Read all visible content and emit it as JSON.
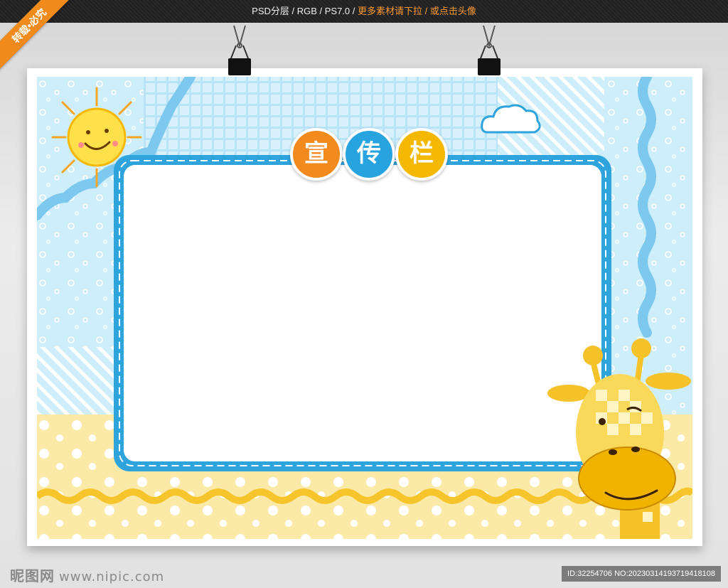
{
  "header": {
    "meta": "PSD分层 / RGB / PS7.0 / ",
    "hint": "更多素材请下拉 / 或点击头像"
  },
  "ribbon": {
    "label": "转载•必究"
  },
  "title_badges": [
    {
      "char": "宣",
      "color": "#f28a1e"
    },
    {
      "char": "传",
      "color": "#27a3e0"
    },
    {
      "char": "栏",
      "color": "#f5b800"
    }
  ],
  "colors": {
    "sky_blue": "#cdeefa",
    "frame_blue": "#2fa3dc",
    "sand_yellow": "#fbe9a8",
    "wave_yellow": "#f6c52c",
    "giraffe": "#f5c22a"
  },
  "icons": [
    "sun-icon",
    "cloud-icon",
    "giraffe-icon",
    "binder-clip-icon"
  ],
  "footer": {
    "logo": "昵图网",
    "url": "www.nipic.com",
    "id_text": "ID:32254706 NO:20230314193719418108"
  }
}
